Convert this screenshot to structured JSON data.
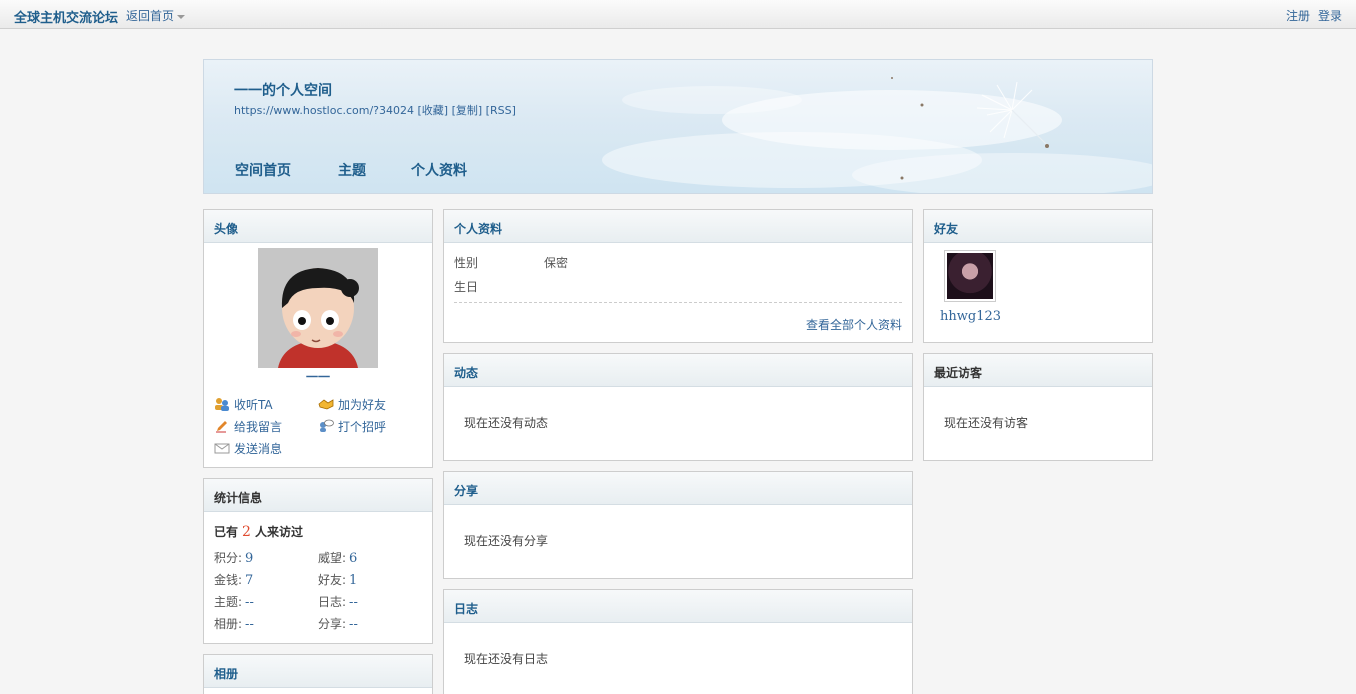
{
  "topbar": {
    "site": "全球主机交流论坛",
    "home": "返回首页",
    "register": "注册",
    "login": "登录"
  },
  "header": {
    "title": "一一的个人空间",
    "url": "https://www.hostloc.com/?34024 [收藏] [复制] [RSS]",
    "nav": [
      "空间首页",
      "主题",
      "个人资料"
    ]
  },
  "avatar_panel": {
    "title": "头像",
    "username": "一一",
    "actions": [
      "收听TA",
      "加为好友",
      "给我留言",
      "打个招呼",
      "发送消息"
    ]
  },
  "stats_panel": {
    "title": "统计信息",
    "visit_prefix": "已有",
    "visit_count": "2",
    "visit_suffix": "人来访过",
    "items": [
      {
        "label": "积分:",
        "value": "9"
      },
      {
        "label": "威望:",
        "value": "6"
      },
      {
        "label": "金钱:",
        "value": "7"
      },
      {
        "label": "好友:",
        "value": "1"
      },
      {
        "label": "主题:",
        "value": "--"
      },
      {
        "label": "日志:",
        "value": "--"
      },
      {
        "label": "相册:",
        "value": "--"
      },
      {
        "label": "分享:",
        "value": "--"
      }
    ]
  },
  "album_panel": {
    "title": "相册"
  },
  "profile_panel": {
    "title": "个人资料",
    "gender_label": "性别",
    "gender_value": "保密",
    "birthday_label": "生日",
    "more": "查看全部个人资料"
  },
  "feed_panel": {
    "title": "动态",
    "empty": "现在还没有动态"
  },
  "share_panel": {
    "title": "分享",
    "empty": "现在还没有分享"
  },
  "blog_panel": {
    "title": "日志",
    "empty": "现在还没有日志"
  },
  "friends_panel": {
    "title": "好友",
    "friend_name": "hhwg123"
  },
  "visitors_panel": {
    "title": "最近访客",
    "empty": "现在还没有访客"
  }
}
